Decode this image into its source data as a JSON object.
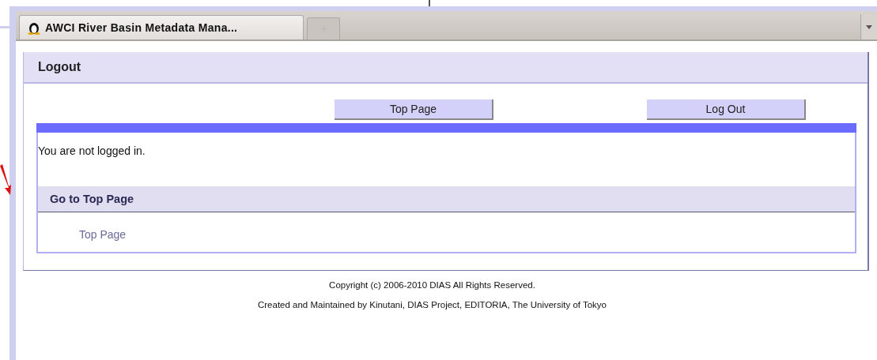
{
  "browser": {
    "tabs": [
      {
        "title": "AWCI River Basin Metadata Mana...",
        "selected": true
      }
    ]
  },
  "panel": {
    "title": "Logout",
    "buttons": [
      {
        "label": "Top Page"
      },
      {
        "label": "Log Out"
      }
    ],
    "message": "You are not logged in.",
    "section": {
      "title": "Go to Top Page",
      "links": [
        "Top Page"
      ]
    }
  },
  "footer": [
    "Copyright (c) 2006-2010 DIAS All Rights Reserved.",
    "Created and Maintained by Kinutani, DIAS Project, EDITORIA, The University of Tokyo"
  ]
}
